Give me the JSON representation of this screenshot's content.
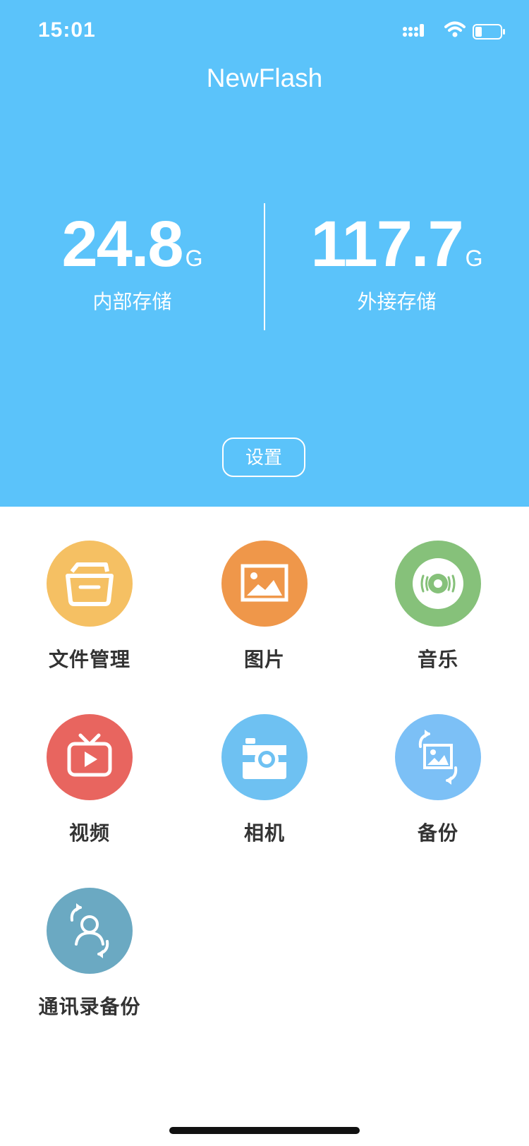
{
  "status_bar": {
    "time": "15:01",
    "icons": [
      "signal-icon",
      "wifi-icon",
      "battery-icon"
    ]
  },
  "app": {
    "title": "NewFlash"
  },
  "storage": {
    "internal": {
      "value": "24.8",
      "unit": "G",
      "label": "内部存储"
    },
    "external": {
      "value": "117.7",
      "unit": "G",
      "label": "外接存储"
    }
  },
  "settings_button": {
    "label": "设置"
  },
  "grid": [
    {
      "label": "文件管理",
      "icon": "folder-icon",
      "color": "#f5c063"
    },
    {
      "label": "图片",
      "icon": "picture-icon",
      "color": "#ef974a"
    },
    {
      "label": "音乐",
      "icon": "music-disc-icon",
      "color": "#86c17a"
    },
    {
      "label": "视频",
      "icon": "tv-play-icon",
      "color": "#e8655f"
    },
    {
      "label": "相机",
      "icon": "camera-icon",
      "color": "#6ec1f2"
    },
    {
      "label": "备份",
      "icon": "photo-backup-icon",
      "color": "#7cc0f6"
    },
    {
      "label": "通讯录备份",
      "icon": "contacts-backup-icon",
      "color": "#6ba9c2"
    }
  ],
  "colors": {
    "header_bg": "#5bc3fa",
    "text_dark": "#333333"
  }
}
